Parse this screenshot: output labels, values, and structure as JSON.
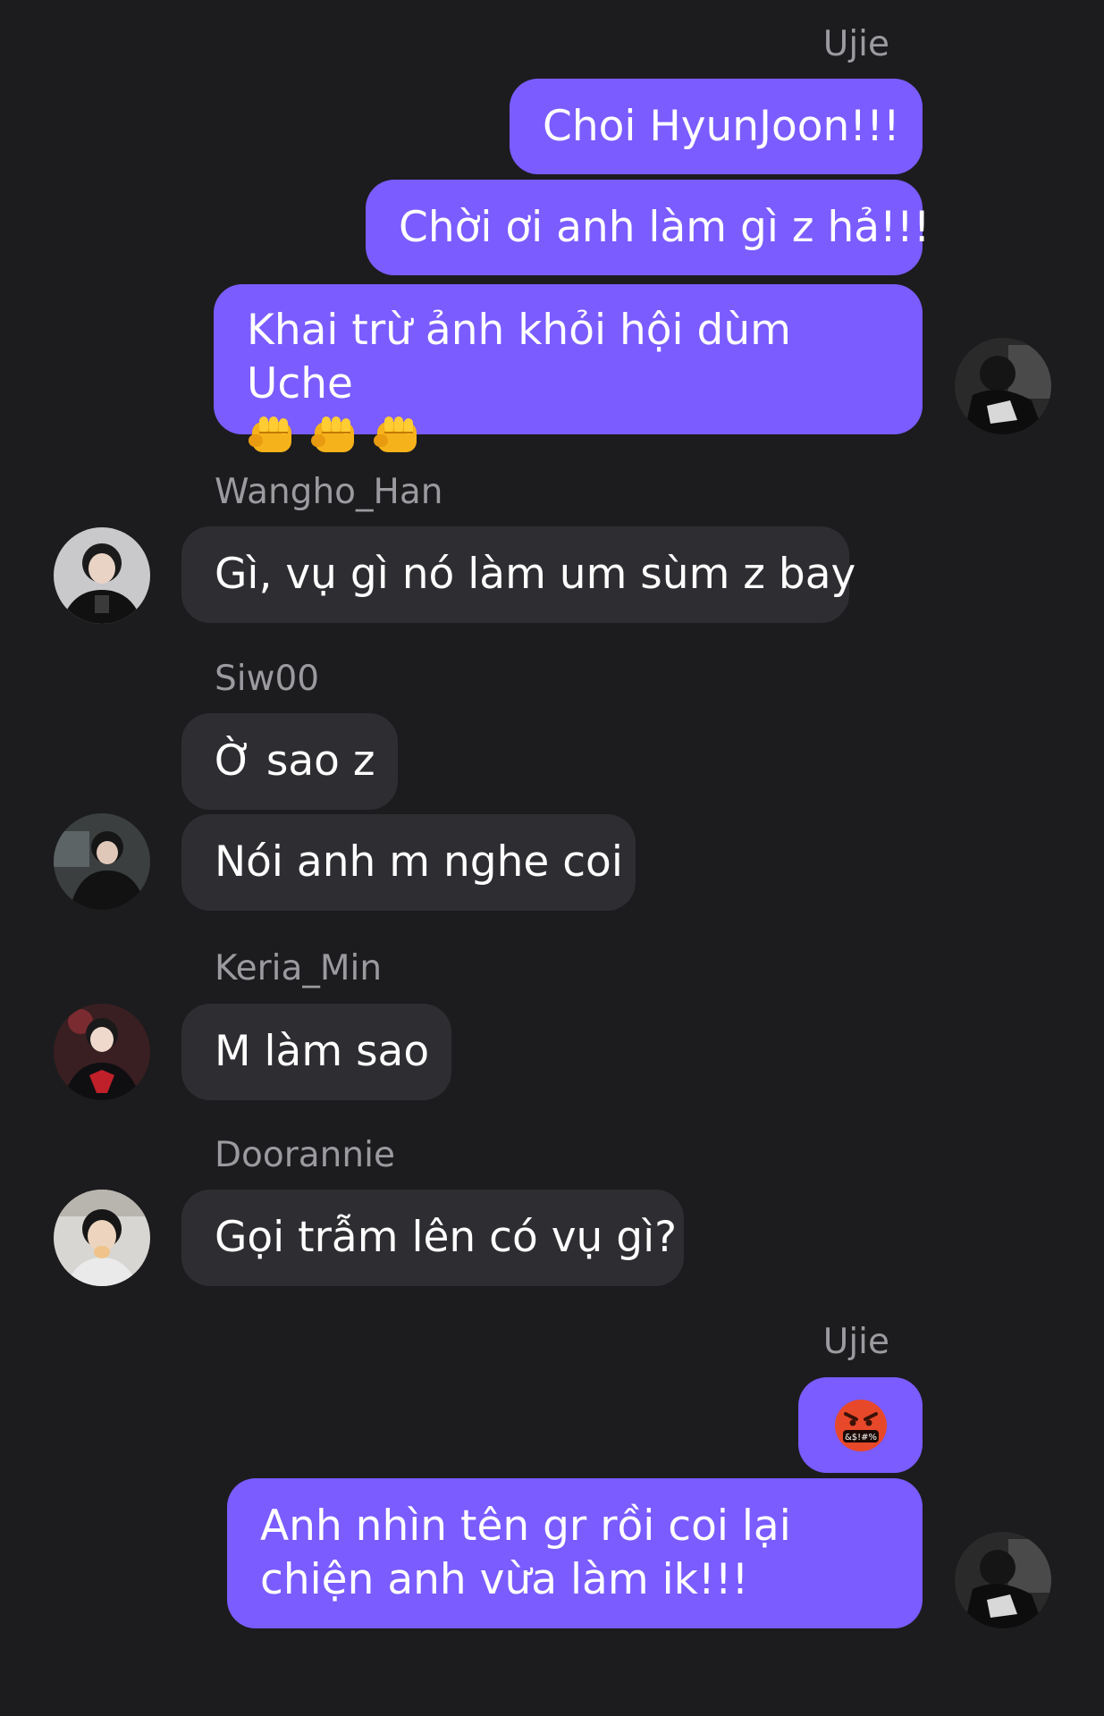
{
  "messages": {
    "ujie_1": {
      "sender": "Ujie",
      "msg1": "Choi HyunJoon!!!",
      "msg2": "Chời ơi anh làm gì z hả!!!",
      "msg3": "Khai trừ ảnh khỏi hội dùm Uche",
      "msg3_emoji": "oncoming-fist x3"
    },
    "wangho": {
      "sender": "Wangho_Han",
      "msg1": "Gì, vụ gì nó làm um sùm z bay"
    },
    "siwoo": {
      "sender": "Siw00",
      "msg1": "Ờ sao z",
      "msg2": "Nói anh m nghe coi"
    },
    "keria": {
      "sender": "Keria_Min",
      "msg1": "M làm sao"
    },
    "doorannie": {
      "sender": "Doorannie",
      "msg1": "Gọi trẫm lên có vụ gì?"
    },
    "ujie_2": {
      "sender": "Ujie",
      "msg1_emoji": "face-with-symbols-on-mouth",
      "msg2": "Anh nhìn tên gr rồi coi lại chiện anh vừa làm ik!!!"
    }
  },
  "colors": {
    "background": "#1c1c1e",
    "outgoing_bubble": "#7a5cff",
    "incoming_bubble": "#2e2e32",
    "sender_name": "#9a9a9f"
  }
}
